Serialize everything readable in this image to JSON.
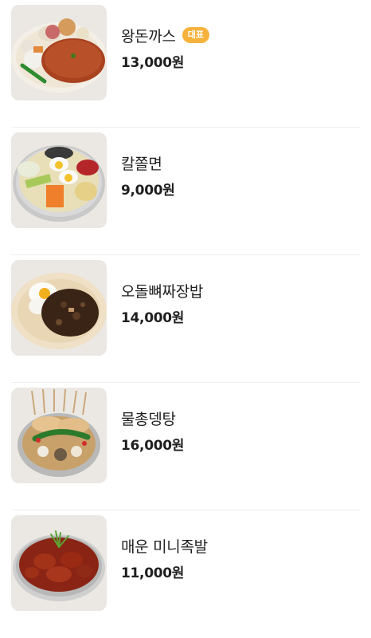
{
  "menu": {
    "items": [
      {
        "name": "왕돈까스",
        "badge": "대표",
        "price": "13,000원"
      },
      {
        "name": "칼쫄면",
        "badge": "",
        "price": "9,000원"
      },
      {
        "name": "오돌뼈짜장밥",
        "badge": "",
        "price": "14,000원"
      },
      {
        "name": "물총뎅탕",
        "badge": "",
        "price": "16,000원"
      },
      {
        "name": "매운 미니족발",
        "badge": "",
        "price": "11,000원"
      }
    ]
  },
  "colors": {
    "badge": "#f6b23b",
    "divider": "#efefef"
  }
}
